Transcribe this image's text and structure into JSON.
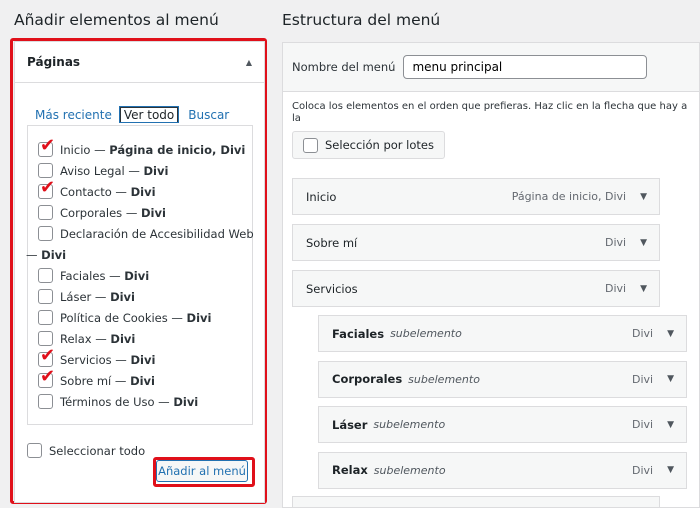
{
  "left": {
    "title": "Añadir elementos al menú",
    "section": "Páginas",
    "tabs": [
      "Más reciente",
      "Ver todo",
      "Buscar"
    ],
    "active_tab": "Ver todo",
    "pages": [
      {
        "name": "Inicio",
        "meta": "Página de inicio, Divi",
        "checked": true
      },
      {
        "name": "Aviso Legal",
        "meta": "Divi",
        "checked": false
      },
      {
        "name": "Contacto",
        "meta": "Divi",
        "checked": true
      },
      {
        "name": "Corporales",
        "meta": "Divi",
        "checked": false
      },
      {
        "name": "Declaración de Accesibilidad Web",
        "meta": "Divi",
        "checked": false
      },
      {
        "name": "Faciales",
        "meta": "Divi",
        "checked": false
      },
      {
        "name": "Láser",
        "meta": "Divi",
        "checked": false
      },
      {
        "name": "Política de Cookies",
        "meta": "Divi",
        "checked": false
      },
      {
        "name": "Relax",
        "meta": "Divi",
        "checked": false
      },
      {
        "name": "Servicios",
        "meta": "Divi",
        "checked": true
      },
      {
        "name": "Sobre mí",
        "meta": "Divi",
        "checked": true
      },
      {
        "name": "Términos de Uso",
        "meta": "Divi",
        "checked": false
      }
    ],
    "select_all": "Seleccionar todo",
    "add_button": "Añadir al menú"
  },
  "right": {
    "title": "Estructura del menú",
    "name_label": "Nombre del menú",
    "name_value": "menu principal",
    "instructions": "Coloca los elementos en el orden que prefieras. Haz clic en la flecha que hay a la",
    "bulk": "Selección por lotes",
    "items": [
      {
        "title": "Inicio",
        "type": "Página de inicio, Divi"
      },
      {
        "title": "Sobre mí",
        "type": "Divi"
      },
      {
        "title": "Servicios",
        "type": "Divi"
      }
    ],
    "subitems": [
      {
        "title": "Faciales",
        "sub": "subelemento",
        "type": "Divi"
      },
      {
        "title": "Corporales",
        "sub": "subelemento",
        "type": "Divi"
      },
      {
        "title": "Láser",
        "sub": "subelemento",
        "type": "Divi"
      },
      {
        "title": "Relax",
        "sub": "subelemento",
        "type": "Divi"
      }
    ]
  },
  "colors": {
    "highlight": "#e0101a",
    "link": "#2271b1"
  }
}
